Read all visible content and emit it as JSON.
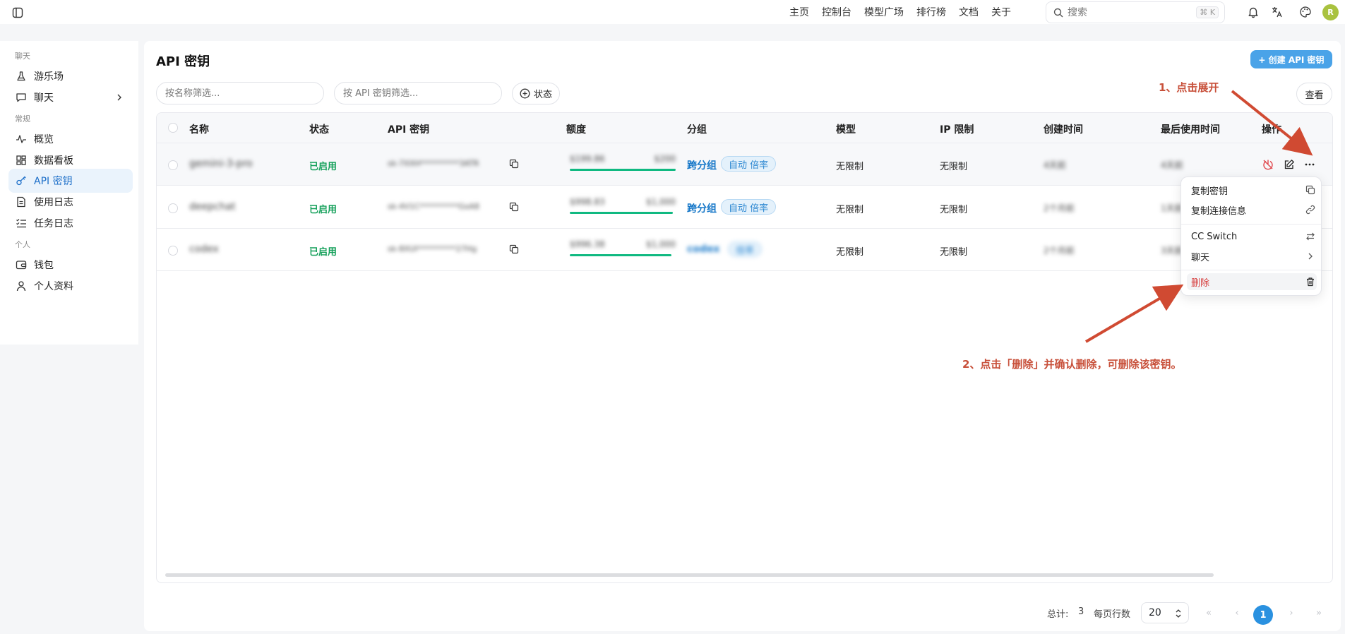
{
  "topbar": {
    "nav": [
      "主页",
      "控制台",
      "模型广场",
      "排行榜",
      "文档",
      "关于"
    ],
    "search_placeholder": "搜索",
    "search_shortcut": "⌘ K",
    "avatar_letter": "R",
    "avatar_color": "#a9c23f"
  },
  "sidebar": {
    "group_chat": "聊天",
    "group_general": "常规",
    "group_personal": "个人",
    "items": [
      {
        "label": "游乐场",
        "icon": "flask-icon"
      },
      {
        "label": "聊天",
        "icon": "chat-icon"
      },
      {
        "label": "概览",
        "icon": "activity-icon"
      },
      {
        "label": "数据看板",
        "icon": "dashboard-icon"
      },
      {
        "label": "API 密钥",
        "icon": "key-icon",
        "active": true
      },
      {
        "label": "使用日志",
        "icon": "log-icon"
      },
      {
        "label": "任务日志",
        "icon": "task-list-icon"
      },
      {
        "label": "钱包",
        "icon": "wallet-icon"
      },
      {
        "label": "个人资料",
        "icon": "user-icon"
      }
    ]
  },
  "main": {
    "title": "API 密钥",
    "create_button": "+ 创建 API 密钥",
    "filter_name_placeholder": "按名称筛选...",
    "filter_key_placeholder": "按 API 密钥筛选...",
    "status_button": "状态",
    "view_button": "查看"
  },
  "table": {
    "headers": [
      "名称",
      "状态",
      "API 密钥",
      "额度",
      "分组",
      "模型",
      "IP 限制",
      "创建时间",
      "最后使用时间",
      "操作"
    ],
    "rows": [
      {
        "name": "gemini-3-pro",
        "status": "已启用",
        "key": "sk-7XXH**********3ATR",
        "quota_used": "$199.86",
        "quota_total": "$200",
        "group": "跨分组",
        "group_tag": "自动 倍率",
        "model": "无限制",
        "ip": "无限制",
        "created": "4天前",
        "last_used": "4天前"
      },
      {
        "name": "deepchat",
        "status": "已启用",
        "key": "sk-4V1C**********GxA8",
        "quota_used": "$998.83",
        "quota_total": "$1,000",
        "group": "跨分组",
        "group_tag": "自动 倍率",
        "model": "无限制",
        "ip": "无限制",
        "created": "2个月前",
        "last_used": "1天前"
      },
      {
        "name": "codex",
        "status": "已启用",
        "key": "sk-8XUI**********27Hg",
        "quota_used": "$996.38",
        "quota_total": "$1,000",
        "group": "codex",
        "group_tag": "倍率",
        "model": "无限制",
        "ip": "无限制",
        "created": "2个月前",
        "last_used": "3天前"
      }
    ]
  },
  "dropdown": {
    "copy_key": "复制密钥",
    "copy_connection": "复制连接信息",
    "cc_switch": "CC Switch",
    "chat": "聊天",
    "delete": "删除"
  },
  "annotations": {
    "step1": "1、点击展开",
    "step2": "2、点击「删除」并确认删除，可删除该密钥。",
    "color": "#c8503a"
  },
  "pagination": {
    "total_label": "总计:",
    "total": "3",
    "rows_per_page_label": "每页行数",
    "page_size": "20",
    "current_page": "1"
  },
  "colors": {
    "accent": "#2a91e0",
    "enabled": "#14a05a",
    "quota_bar": "#10b981",
    "danger": "#d63b3b"
  }
}
